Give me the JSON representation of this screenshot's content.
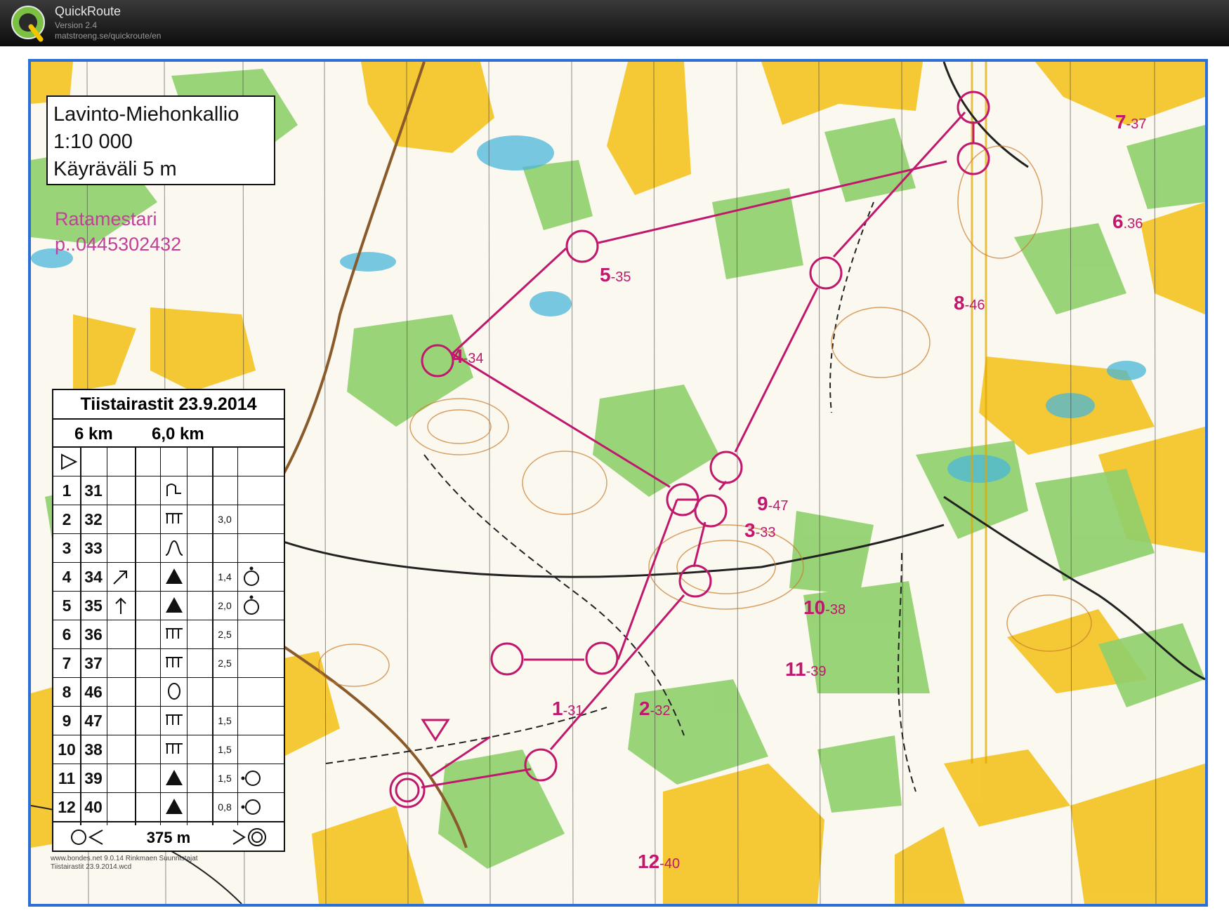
{
  "app": {
    "name": "QuickRoute",
    "version": "Version 2.4",
    "url": "matstroeng.se/quickroute/en"
  },
  "map_info": {
    "name": "Lavinto-Miehonkallio",
    "scale": "1:10 000",
    "contour": "Käyräväli 5 m"
  },
  "course_setter": {
    "title": "Ratamestari",
    "phone": "p..0445302432"
  },
  "controls": [
    {
      "number": "1",
      "code": "-31"
    },
    {
      "number": "2",
      "code": "-32"
    },
    {
      "number": "3",
      "code": "-33"
    },
    {
      "number": "4",
      "code": "-34"
    },
    {
      "number": "5",
      "code": "-35"
    },
    {
      "number": "6",
      "code": ".36"
    },
    {
      "number": "7",
      "code": "-37"
    },
    {
      "number": "8",
      "code": "-46"
    },
    {
      "number": "9",
      "code": "-47"
    },
    {
      "number": "10",
      "code": "-38"
    },
    {
      "number": "11",
      "code": "-39"
    },
    {
      "number": "12",
      "code": "-40"
    }
  ],
  "description_sheet": {
    "title": "Tiistairastit 23.9.2014",
    "course": "6 km",
    "length": "6,0 km",
    "start_symbol": "start-triangle",
    "rows": [
      {
        "no": "1",
        "code": "31",
        "direction": "",
        "feature": "foot-of-cliff-symbol",
        "size": "",
        "location": ""
      },
      {
        "no": "2",
        "code": "32",
        "direction": "",
        "feature": "cliff-symbol",
        "size": "3,0",
        "location": ""
      },
      {
        "no": "3",
        "code": "33",
        "direction": "",
        "feature": "re-entrant-symbol",
        "size": "",
        "location": ""
      },
      {
        "no": "4",
        "code": "34",
        "direction": "NE",
        "feature": "boulder-symbol",
        "size": "1,4",
        "location": "top-symbol"
      },
      {
        "no": "5",
        "code": "35",
        "direction": "N",
        "feature": "boulder-symbol",
        "size": "2,0",
        "location": "top-symbol"
      },
      {
        "no": "6",
        "code": "36",
        "direction": "",
        "feature": "cliff-symbol",
        "size": "2,5",
        "location": ""
      },
      {
        "no": "7",
        "code": "37",
        "direction": "",
        "feature": "cliff-symbol",
        "size": "2,5",
        "location": ""
      },
      {
        "no": "8",
        "code": "46",
        "direction": "",
        "feature": "depression-symbol",
        "size": "",
        "location": ""
      },
      {
        "no": "9",
        "code": "47",
        "direction": "",
        "feature": "cliff-symbol",
        "size": "1,5",
        "location": ""
      },
      {
        "no": "10",
        "code": "38",
        "direction": "",
        "feature": "cliff-symbol",
        "size": "1,5",
        "location": ""
      },
      {
        "no": "11",
        "code": "39",
        "direction": "",
        "feature": "boulder-symbol",
        "size": "1,5",
        "location": "side-symbol"
      },
      {
        "no": "12",
        "code": "40",
        "direction": "",
        "feature": "boulder-symbol",
        "size": "0,8",
        "location": "side-symbol"
      }
    ],
    "finish_distance": "375 m"
  },
  "print_footer": {
    "line1": "www.bondes.net 9.0.14 Rinkmaen Suunnistajat",
    "line2": "Tiistairastit 23.9.2014.wcd"
  },
  "colors": {
    "course": "#c0186d",
    "frame": "#2b6fd6",
    "open_land": "#f4c52b",
    "forest_green": "#8fcf6b",
    "water": "#49b7d9",
    "white_forest": "#fbf8ef"
  }
}
